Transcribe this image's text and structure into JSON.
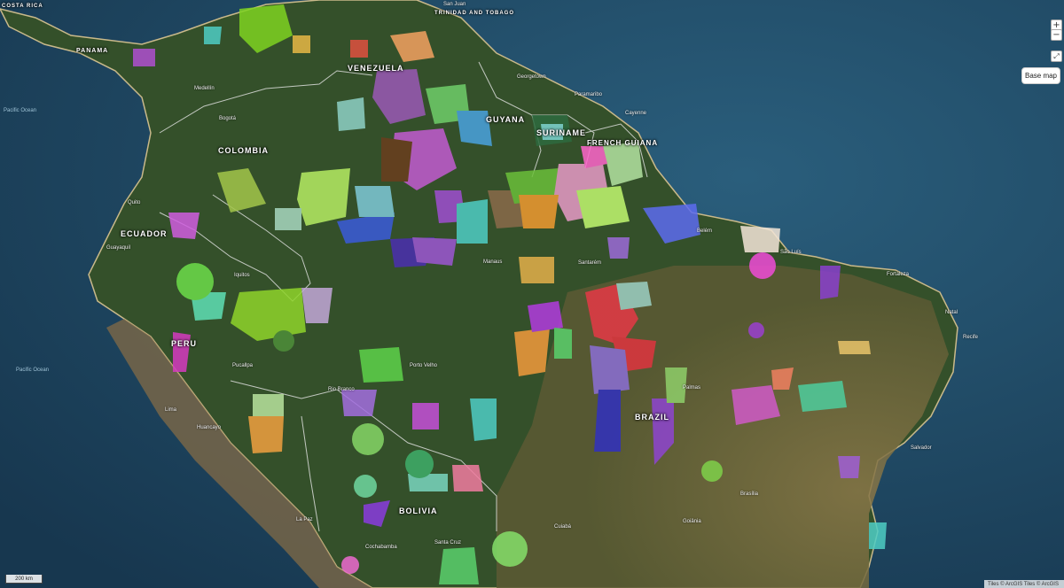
{
  "map": {
    "countries": [
      "COSTA RICA",
      "PANAMA",
      "VENEZUELA",
      "TRINIDAD AND TOBAGO",
      "COLOMBIA",
      "GUYANA",
      "SURINAME",
      "FRENCH GUIANA",
      "ECUADOR",
      "PERU",
      "BRAZIL",
      "BOLIVIA"
    ],
    "cities": [
      "San Juan",
      "Georgetown",
      "Paramaribo",
      "Cayenne",
      "Manaus",
      "Belém",
      "São Luís",
      "Fortaleza",
      "Natal",
      "Recife",
      "Salvador",
      "Brasília",
      "Goiânia",
      "Huancayo",
      "Lima",
      "Bogotá",
      "Medellín",
      "Quito",
      "Guayaquil",
      "Iquitos",
      "Pucallpa",
      "Porto Velho",
      "Rio Branco",
      "Santarém",
      "Palmas",
      "Cuiabá",
      "La Paz",
      "Cochabamba",
      "Santa Cruz"
    ],
    "ocean": "Pacific Ocean"
  },
  "controls": {
    "zoom_in": "+",
    "zoom_out": "−",
    "fullscreen": "⤢",
    "basemap_label": "Base map",
    "scale_label": "200 km",
    "attribution": "Tiles © ArcGIS Tiles © ArcGIS"
  },
  "colors": {
    "ocean": "#1d4560",
    "land_forest": "#2f4a26",
    "land_dry": "#7a6a3e",
    "overlay": [
      "#7ed321",
      "#9b59b6",
      "#3b5bdb",
      "#e63946",
      "#c2f970",
      "#4ecdc4",
      "#ff66cc",
      "#f4a261",
      "#e9c46a",
      "#8a2be2"
    ]
  }
}
